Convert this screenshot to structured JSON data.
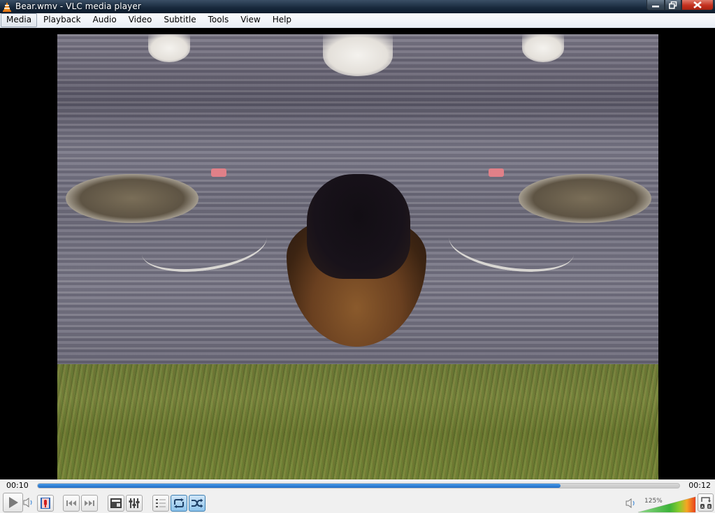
{
  "window": {
    "title": "Bear.wmv - VLC media player",
    "app_icon": "vlc-cone-icon",
    "buttons": {
      "minimize": "minimize-icon",
      "restore": "restore-icon",
      "close": "close-icon"
    }
  },
  "menubar": {
    "items": [
      {
        "label": "Media",
        "active": true
      },
      {
        "label": "Playback"
      },
      {
        "label": "Audio"
      },
      {
        "label": "Video"
      },
      {
        "label": "Subtitle"
      },
      {
        "label": "Tools"
      },
      {
        "label": "View"
      },
      {
        "label": "Help"
      }
    ]
  },
  "video": {
    "description": "Mirrored/kaleidoscope video effect showing bear head and swans on water over grass"
  },
  "playback": {
    "elapsed": "00:10",
    "total": "00:12",
    "progress_percent": 81.5
  },
  "controls": {
    "play": "play-icon",
    "record": "record-icon",
    "previous": "previous-icon",
    "next": "next-icon",
    "fullscreen": "fullscreen-icon",
    "extended_settings": "extended-settings-icon",
    "playlist": "playlist-icon",
    "loop": {
      "icon": "loop-icon",
      "active": true
    },
    "random": {
      "icon": "random-icon",
      "active": true
    },
    "ab_loop": "ab-loop-icon"
  },
  "volume": {
    "label": "125%",
    "percent": 125,
    "max_percent": 125
  },
  "colors": {
    "seek_fill": "#1e6cc8",
    "toggle_active": "#8ec4ec",
    "close_red": "#c3311f"
  }
}
